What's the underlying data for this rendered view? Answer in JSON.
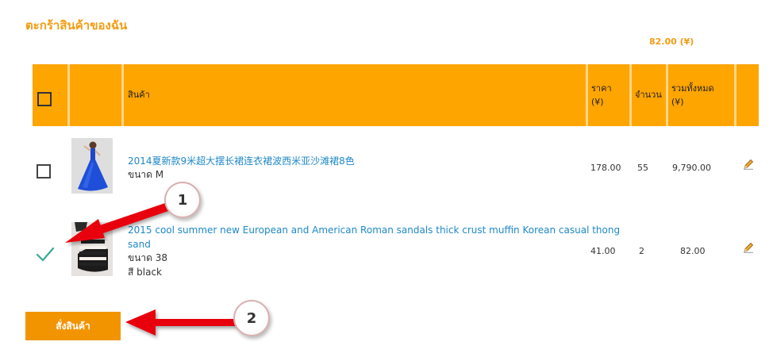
{
  "page": {
    "title": "ตะกร้าสินค้าของฉัน",
    "total_top": "82.00 (¥)"
  },
  "table": {
    "headers": {
      "product": "สินค้า",
      "price_line1": "ราคา",
      "price_line2": "(¥)",
      "quantity": "จำนวน",
      "total_line1": "รวมทั้งหมด",
      "total_line2": "(¥)"
    },
    "rows": [
      {
        "name": "2014夏新款9米超大摆长裙连衣裙波西米亚沙滩裙8色",
        "attr1": "ขนาด M",
        "attr2": "",
        "price": "178.00",
        "qty": "55",
        "total": "9,790.00",
        "checked": false
      },
      {
        "name_line1": "2015 cool summer new European and American Roman sandals thick crust muffin Korean casual thong",
        "name_line2": "sand",
        "attr1": "ขนาด 38",
        "attr2": "สี black",
        "price": "41.00",
        "qty": "2",
        "total": "82.00",
        "checked": true
      }
    ]
  },
  "order_button": {
    "label": "สั่งสินค้า"
  },
  "annotations": [
    {
      "number": "1"
    },
    {
      "number": "2"
    }
  ],
  "colors": {
    "accent": "#ffa500",
    "button": "#f29400",
    "link": "#1e88c7",
    "check": "#3aa89a",
    "arrow": "#e8000b"
  },
  "icons": [
    "checkbox-icon",
    "checkmark-icon",
    "pencil-edit-icon"
  ]
}
